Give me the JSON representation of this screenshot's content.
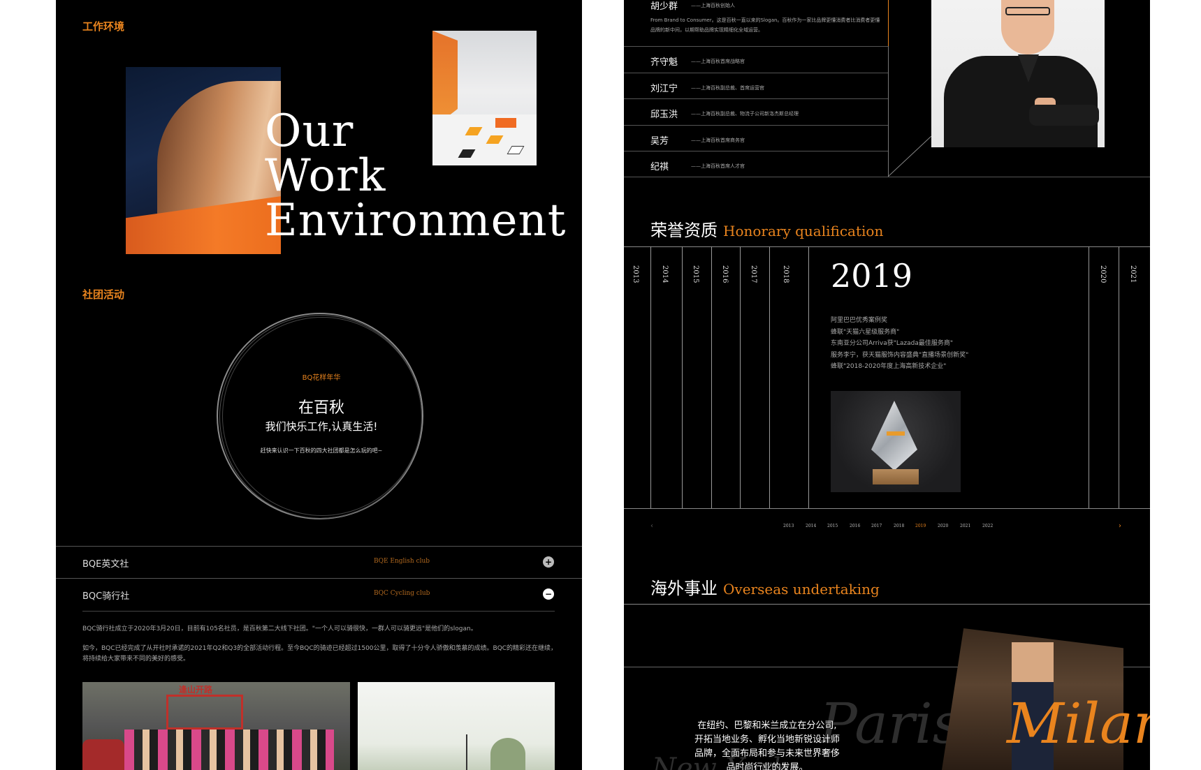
{
  "left": {
    "work_env_label": "工作环境",
    "hero_title": [
      "Our",
      "Work",
      "Environment"
    ],
    "community_label": "社团活动",
    "circle": {
      "small": "BQ花样年华",
      "big": "在百秋",
      "mid": "我们快乐工作,认真生活!",
      "tiny": "赶快来认识一下百秋的四大社团都是怎么玩的吧~"
    },
    "clubs": [
      {
        "name": "BQE英文社",
        "en": "BQE English club",
        "toggle": "+"
      },
      {
        "name": "BQC骑行社",
        "en": "BQC Cycling club",
        "toggle": "−"
      }
    ],
    "para1": "BQC骑行社成立于2020年3月20日，目前有105名社员，是百秋第二大线下社团。\"一个人可以骑很快，一群人可以骑更远\"是他们的slogan。",
    "para2": "如今，BQC已经完成了从开社时承诺的2021年Q2和Q3的全部活动行程。至今BQC的骑迹已经超过1500公里，取得了十分令人骄傲和羡慕的成绩。BQC的精彩还在继续，将持续给大家带来不同的美好的感受。",
    "photo_sign": "逢山开路"
  },
  "right": {
    "founder": {
      "name": "胡少群",
      "title": "——上海百秋创始人"
    },
    "founder_desc": "From Brand to Consumer。这是百秋一直以来的Slogan。百秋作为一家比品牌更懂消费者比消费者更懂品牌的新中间，以期帮助品牌实现精细化全域运营。",
    "leaders": [
      {
        "name": "齐守魁",
        "title": "——上海百秋首席战略官"
      },
      {
        "name": "刘江宁",
        "title": "——上海百秋副总裁、首席运营官"
      },
      {
        "name": "邱玉洪",
        "title": "——上海百秋副总裁、物流子公司新洛杰斯总经理"
      },
      {
        "name": "吴芳",
        "title": "——上海百秋首席商务官"
      },
      {
        "name": "纪祺",
        "title": "——上海百秋首席人才官"
      }
    ],
    "honor": {
      "cn": "荣誉资质",
      "en": "Honorary qualification"
    },
    "years_left": [
      "2013",
      "2014",
      "2015",
      "2016",
      "2017",
      "2018"
    ],
    "years_right": [
      "2020",
      "2021"
    ],
    "selected_year": "2019",
    "awards": [
      "阿里巴巴优秀案例奖",
      "蜂联\"天猫六星级服务商\"",
      "东南亚分公司Arriva获\"Lazada最佳服务商\"",
      "服务李宁，获天猫服饰内容盛典\"直播场景创新奖\"",
      "蜂联\"2018-2020年度上海高新技术企业\""
    ],
    "timeline": [
      "2013",
      "2014",
      "2015",
      "2016",
      "2017",
      "2018",
      "2019",
      "2020",
      "2021",
      "2022"
    ],
    "arrow_prev": "‹",
    "arrow_next": "›",
    "overseas": {
      "cn": "海外事业",
      "en": "Overseas undertaking"
    },
    "overseas_text": "在纽约、巴黎和米兰成立在分公司,开拓当地业务、孵化当地新锐设计师品牌，全面布局和参与未来世界奢侈品时尚行业的发展。",
    "cities": {
      "paris": "Paris",
      "milan": "Milan",
      "ny": "New York"
    }
  },
  "colors": {
    "accent": "#e9841e",
    "background": "#000000"
  }
}
